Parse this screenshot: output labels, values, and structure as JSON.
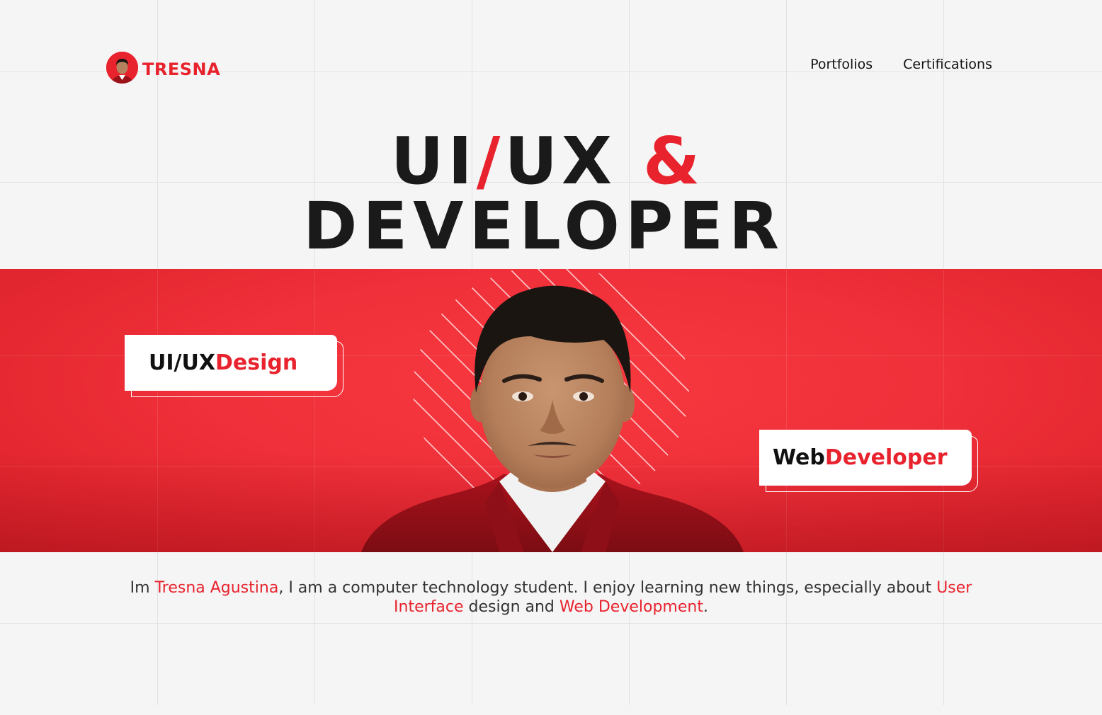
{
  "header": {
    "logo_text": "TRESNA",
    "nav": {
      "portfolios": "Portfolios",
      "certifications": "Certifications"
    }
  },
  "hero": {
    "line1_part1": "UI",
    "line1_slash": "/",
    "line1_part2": "UX ",
    "line1_amp": "&",
    "line2": "DEVELOPER"
  },
  "tags": {
    "uiux": {
      "dark": "UI/UX ",
      "red": "Design"
    },
    "web": {
      "dark": "Web ",
      "red": "Developer"
    }
  },
  "bio": {
    "t1": "Im ",
    "name": "Tresna Agustina",
    "t2": ", I am a computer technology student. I enjoy learning new things, especially about ",
    "hl1": "User Interface",
    "t3": " design and ",
    "hl2": "Web Development",
    "t4": "."
  },
  "colors": {
    "accent": "#e8232e",
    "background": "#f5f5f5",
    "text": "#1a1a1a"
  },
  "icons": {
    "logo": "avatar-photo-icon",
    "pattern": "diagonal-stripes-pattern"
  }
}
